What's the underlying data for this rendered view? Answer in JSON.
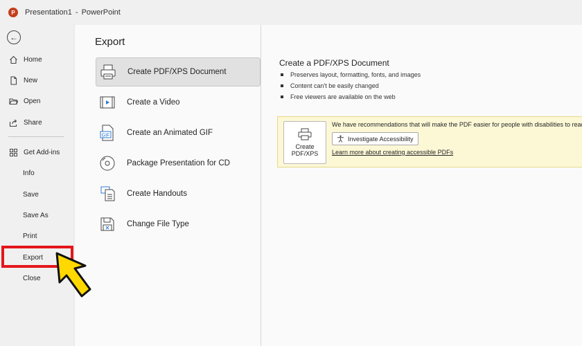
{
  "window": {
    "app_icon_letter": "P",
    "document_name": "Presentation1",
    "separator": "-",
    "app_name": "PowerPoint"
  },
  "sidebar": {
    "items": [
      {
        "label": "Home",
        "icon": "home-icon"
      },
      {
        "label": "New",
        "icon": "new-document-icon"
      },
      {
        "label": "Open",
        "icon": "folder-open-icon"
      },
      {
        "label": "Share",
        "icon": "share-icon"
      },
      {
        "label": "Get Add-ins",
        "icon": "add-ins-grid-icon"
      },
      {
        "label": "Info"
      },
      {
        "label": "Save"
      },
      {
        "label": "Save As"
      },
      {
        "label": "Print"
      },
      {
        "label": "Export",
        "selected": true
      },
      {
        "label": "Close"
      }
    ]
  },
  "main": {
    "title": "Export",
    "options": [
      {
        "label": "Create PDF/XPS Document",
        "icon": "pdf-printer-icon",
        "selected": true
      },
      {
        "label": "Create a Video",
        "icon": "video-film-icon"
      },
      {
        "label": "Create an Animated GIF",
        "icon": "gif-file-icon",
        "icon_text": "GIF"
      },
      {
        "label": "Package Presentation for CD",
        "icon": "cd-disc-icon"
      },
      {
        "label": "Create Handouts",
        "icon": "handouts-icon"
      },
      {
        "label": "Change File Type",
        "icon": "change-file-type-icon"
      }
    ]
  },
  "detail": {
    "title": "Create a PDF/XPS Document",
    "bullets": [
      "Preserves layout, formatting, fonts, and images",
      "Content can't be easily changed",
      "Free viewers are available on the web"
    ],
    "create_button_line1": "Create",
    "create_button_line2": "PDF/XPS",
    "recommendation_text": "We have recommendations that will make the PDF easier for people with disabilities to read.",
    "investigate_label": "Investigate Accessibility",
    "learn_more_link": "Learn more about creating accessible PDFs"
  },
  "annotation": {
    "highlight_color": "#e4161b",
    "cursor_color": "#ffd800"
  }
}
